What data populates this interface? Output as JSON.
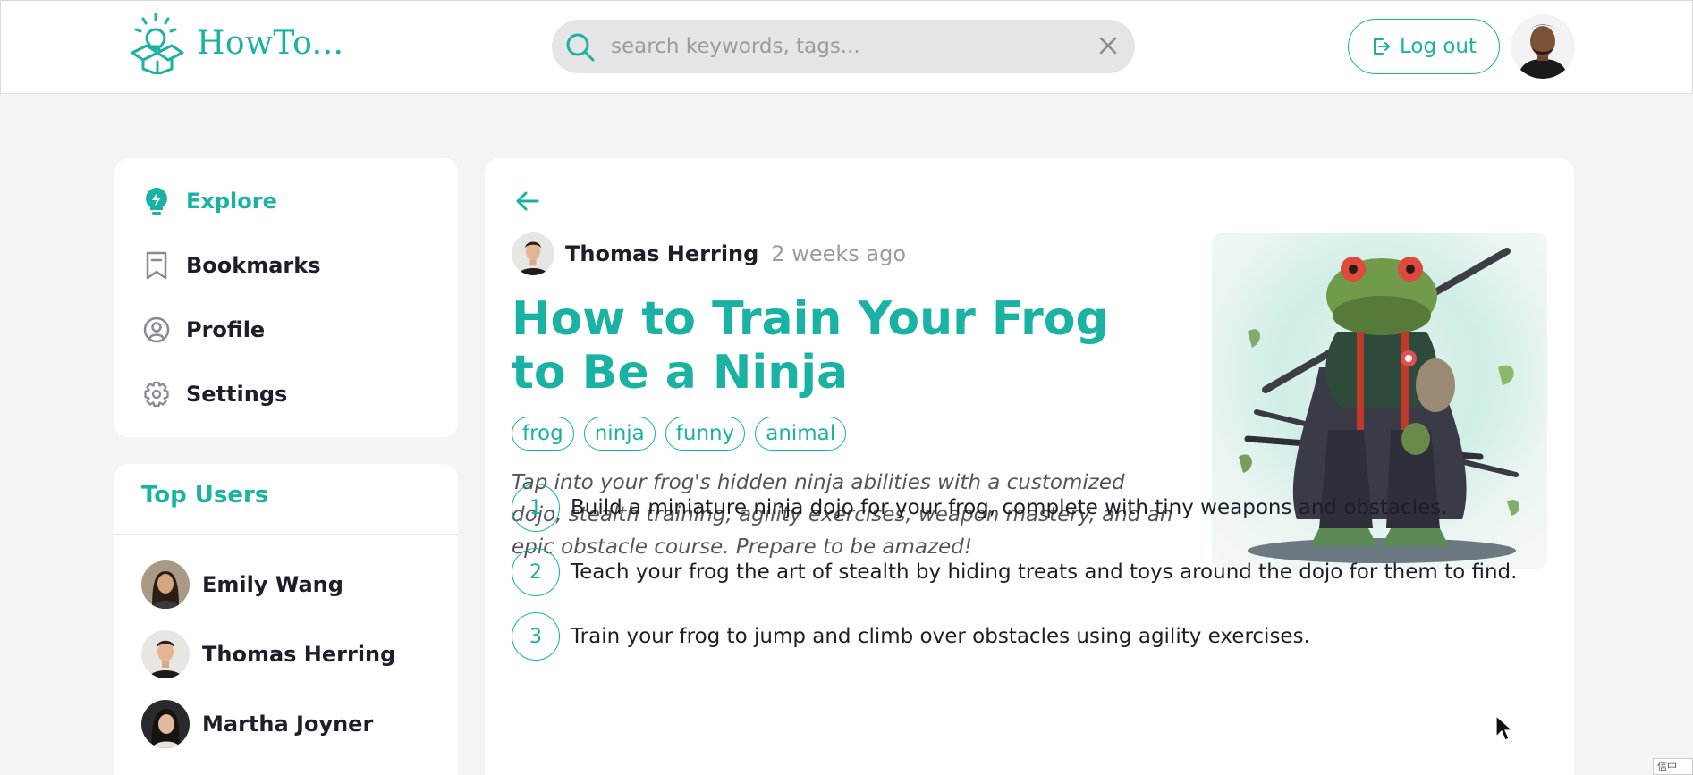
{
  "app": {
    "logo_text": "HowTo..."
  },
  "search": {
    "placeholder": "search keywords, tags...",
    "value": ""
  },
  "header": {
    "logout_label": "Log out"
  },
  "nav": {
    "items": [
      {
        "label": "Explore",
        "icon": "lightbulb-icon",
        "active": true
      },
      {
        "label": "Bookmarks",
        "icon": "bookmark-icon",
        "active": false
      },
      {
        "label": "Profile",
        "icon": "user-circle-icon",
        "active": false
      },
      {
        "label": "Settings",
        "icon": "gear-icon",
        "active": false
      }
    ]
  },
  "top_users": {
    "title": "Top Users",
    "users": [
      {
        "name": "Emily Wang"
      },
      {
        "name": "Thomas Herring"
      },
      {
        "name": "Martha Joyner"
      }
    ]
  },
  "article": {
    "author": "Thomas Herring",
    "time": "2 weeks ago",
    "title": "How to Train Your Frog to Be a Ninja",
    "tags": [
      "frog",
      "ninja",
      "funny",
      "animal"
    ],
    "description": "Tap into your frog's hidden ninja abilities with a customized dojo, stealth training, agility exercises, weapon mastery, and an epic obstacle course. Prepare to be amazed!",
    "steps": [
      {
        "num": "1",
        "text": "Build a miniature ninja dojo for your frog, complete with tiny weapons and obstacles."
      },
      {
        "num": "2",
        "text": "Teach your frog the art of stealth by hiding treats and toys around the dojo for them to find."
      },
      {
        "num": "3",
        "text": "Train your frog to jump and climb over obstacles using agility exercises."
      }
    ]
  },
  "colors": {
    "accent": "#19b2a3",
    "background": "#f4f4f4",
    "text": "#1e1e2a",
    "muted": "#9a9aa0"
  },
  "corner_widget": {
    "text": "信中"
  }
}
